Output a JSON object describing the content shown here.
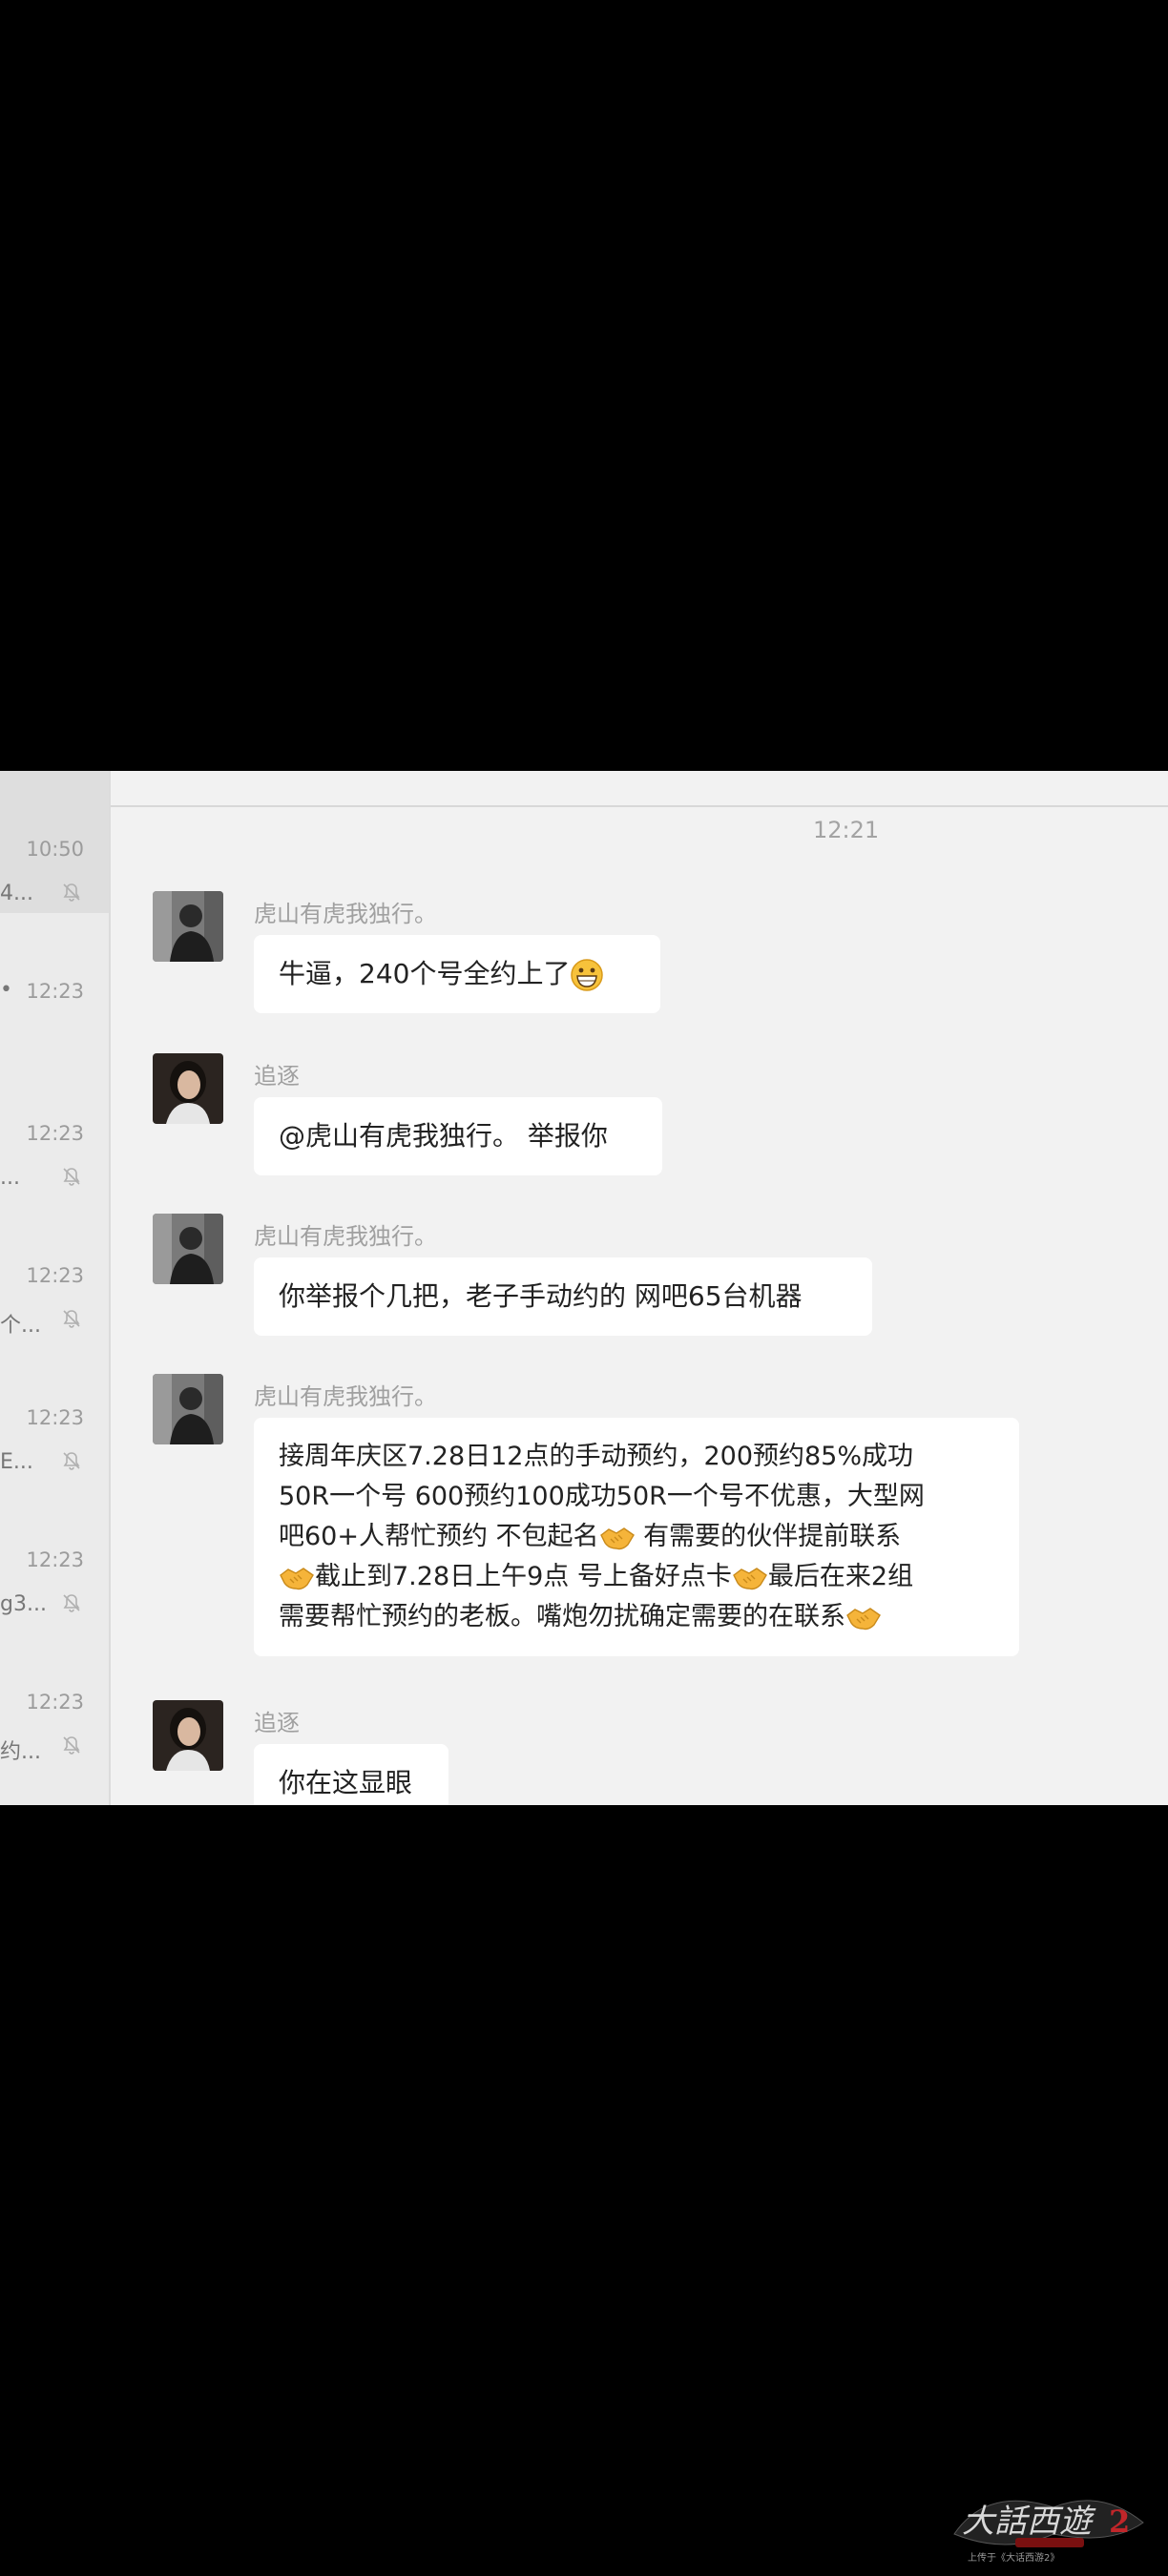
{
  "sidebar": {
    "items": [
      {
        "time": "10:50",
        "frag_top": "",
        "frag_bot": "4...",
        "active": true
      },
      {
        "time": "12:23",
        "frag_top": "•",
        "frag_bot": "",
        "active": false
      },
      {
        "time": "12:23",
        "frag_top": "",
        "frag_bot": "...",
        "active": false
      },
      {
        "time": "12:23",
        "frag_top": "",
        "frag_bot": "个...",
        "active": false
      },
      {
        "time": "12:23",
        "frag_top": "",
        "frag_bot": "E...",
        "active": false
      },
      {
        "time": "12:23",
        "frag_top": "",
        "frag_bot": "g3...",
        "active": false
      },
      {
        "time": "12:23",
        "frag_top": "",
        "frag_bot": "约...",
        "active": false
      }
    ]
  },
  "chat": {
    "timestamp": "12:21",
    "messages": [
      {
        "sender": "虎山有虎我独行。",
        "lines": [
          "牛逼，240个号全约上了"
        ]
      },
      {
        "sender": "追逐",
        "lines": [
          "@虎山有虎我独行。 举报你"
        ]
      },
      {
        "sender": "虎山有虎我独行。",
        "lines": [
          "你举报个几把，老子手动约的 网吧65台机器"
        ]
      },
      {
        "sender": "虎山有虎我独行。",
        "lines": [
          "接周年庆区7.28日12点的手动预约，200预约85%成功",
          "50R一个号 600预约100成功50R一个号不优惠，大型网",
          "吧60+人帮忙预约 不包起名",
          " 有需要的伙伴提前联系",
          "截止到7.28日上午9点 号上备好点卡",
          "最后在来2组",
          "需要帮忙预约的老板。嘴炮勿扰确定需要的在联系"
        ]
      },
      {
        "sender": "追逐",
        "lines": [
          "你在这显眼"
        ]
      }
    ]
  },
  "watermark": {
    "logo_text": "大话西游2",
    "caption": "上传于《大话西游2》"
  }
}
